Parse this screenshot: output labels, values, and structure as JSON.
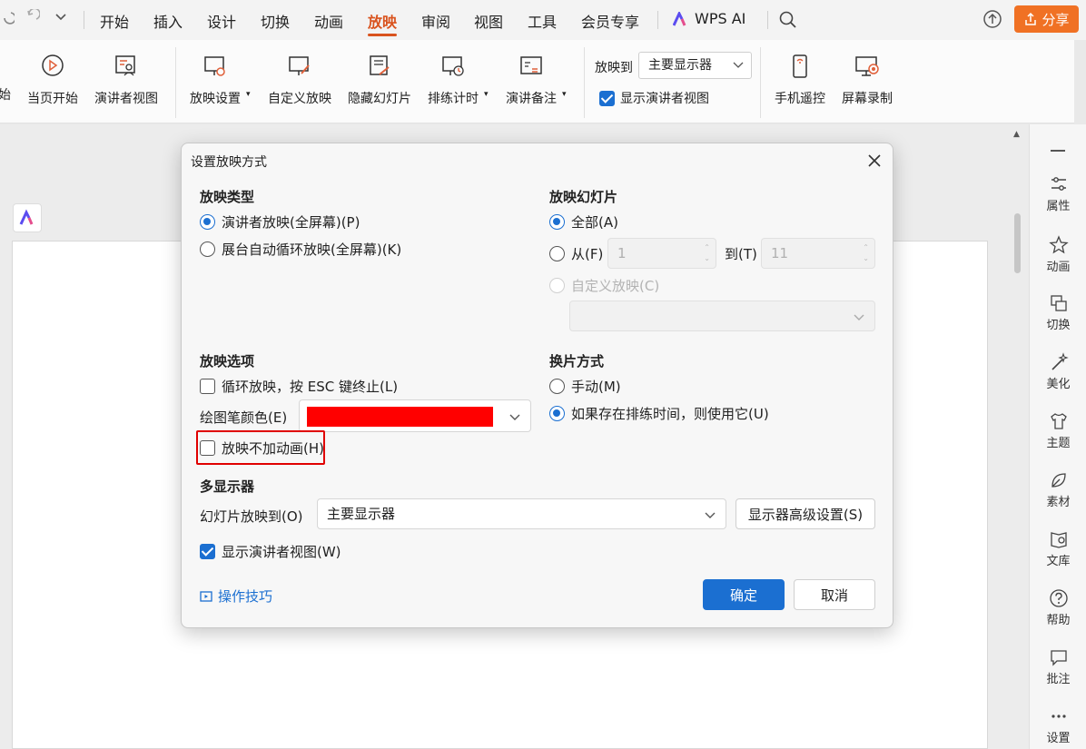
{
  "menubar": {
    "tabs": [
      "开始",
      "插入",
      "设计",
      "切换",
      "动画",
      "放映",
      "审阅",
      "视图",
      "工具",
      "会员专享"
    ],
    "active_tab": "放映",
    "wps_ai": "WPS AI",
    "share": "分享"
  },
  "ribbon": {
    "items": [
      "始",
      "当页开始",
      "演讲者视图",
      "放映设置",
      "自定义放映",
      "隐藏幻灯片",
      "排练计时",
      "演讲备注",
      "手机遥控",
      "屏幕录制"
    ],
    "play_to_label": "放映到",
    "play_to_value": "主要显示器",
    "show_presenter_view": "显示演讲者视图"
  },
  "sidebar": {
    "items": [
      "属性",
      "动画",
      "切换",
      "美化",
      "主题",
      "素材",
      "文库",
      "帮助",
      "批注",
      "设置"
    ]
  },
  "dialog": {
    "title": "设置放映方式",
    "show_type": {
      "title": "放映类型",
      "presenter": "演讲者放映(全屏幕)(P)",
      "kiosk": "展台自动循环放映(全屏幕)(K)"
    },
    "slides": {
      "title": "放映幻灯片",
      "all": "全部(A)",
      "from": "从(F)",
      "from_value": "1",
      "to": "到(T)",
      "to_value": "11",
      "custom": "自定义放映(C)"
    },
    "options": {
      "title": "放映选项",
      "loop": "循环放映，按 ESC 键终止(L)",
      "pen_color_label": "绘图笔颜色(E)",
      "pen_color": "#ff0000",
      "no_animation": "放映不加动画(H)"
    },
    "advance": {
      "title": "换片方式",
      "manual": "手动(M)",
      "timings": "如果存在排练时间，则使用它(U)"
    },
    "monitors": {
      "title": "多显示器",
      "play_to_label": "幻灯片放映到(O)",
      "play_to_value": "主要显示器",
      "advanced_button": "显示器高级设置(S)",
      "show_presenter_view": "显示演讲者视图(W)"
    },
    "tips": "操作技巧",
    "ok": "确定",
    "cancel": "取消"
  }
}
